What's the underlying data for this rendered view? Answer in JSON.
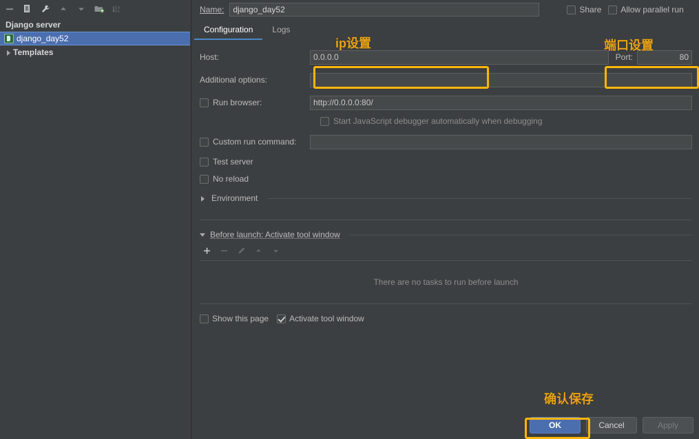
{
  "sidebar": {
    "toolbar": [
      {
        "name": "remove-config-button",
        "icon": "minus-icon"
      },
      {
        "name": "copy-config-button",
        "icon": "copy-icon"
      },
      {
        "name": "edit-templates-button",
        "icon": "wrench-icon"
      },
      {
        "name": "move-up-button",
        "icon": "arrow-up-icon"
      },
      {
        "name": "move-down-button",
        "icon": "arrow-down-icon"
      },
      {
        "name": "move-into-folder-button",
        "icon": "folder-add-icon"
      },
      {
        "name": "sort-configurations-button",
        "icon": "sort-alpha-icon"
      }
    ],
    "tree": [
      {
        "label": "Django server",
        "type": "group",
        "selected": false
      },
      {
        "label": "django_day52",
        "type": "child",
        "selected": true,
        "icon": "django-icon"
      },
      {
        "label": "Templates",
        "type": "group",
        "selected": false,
        "expander": "right"
      }
    ]
  },
  "header": {
    "name_label": "Name:",
    "name_value": "django_day52",
    "share_label": "Share",
    "share_checked": false,
    "allow_parallel_label": "Allow parallel run",
    "allow_parallel_checked": false
  },
  "tabs": [
    {
      "label": "Configuration",
      "active": true
    },
    {
      "label": "Logs",
      "active": false
    }
  ],
  "form": {
    "host_label": "Host:",
    "host_value": "0.0.0.0",
    "port_label": "Port:",
    "port_value": "80",
    "additional_options_label": "Additional options:",
    "additional_options_value": "",
    "run_browser_label": "Run browser:",
    "run_browser_checked": false,
    "run_browser_url": "http://0.0.0.0:80/",
    "js_debugger_label": "Start JavaScript debugger automatically when debugging",
    "js_debugger_checked": false,
    "custom_run_command_label": "Custom run command:",
    "custom_run_command_checked": false,
    "custom_run_command_value": "",
    "test_server_label": "Test server",
    "test_server_checked": false,
    "no_reload_label": "No reload",
    "no_reload_checked": false,
    "environment_label": "Environment"
  },
  "before_launch": {
    "title": "Before launch: Activate tool window",
    "toolbar": [
      {
        "name": "add-task-button",
        "icon": "plus-icon",
        "enabled": true
      },
      {
        "name": "remove-task-button",
        "icon": "minus-icon",
        "enabled": false
      },
      {
        "name": "edit-task-button",
        "icon": "pencil-icon",
        "enabled": false
      },
      {
        "name": "task-move-up-button",
        "icon": "arrow-up-icon",
        "enabled": false
      },
      {
        "name": "task-move-down-button",
        "icon": "arrow-down-icon",
        "enabled": false
      }
    ],
    "empty_text": "There are no tasks to run before launch",
    "show_this_page_label": "Show this page",
    "show_this_page_checked": false,
    "activate_tool_window_label": "Activate tool window",
    "activate_tool_window_checked": true
  },
  "buttons": {
    "ok": "OK",
    "cancel": "Cancel",
    "apply": "Apply"
  },
  "annotations": [
    {
      "text": "ip设置",
      "name": "annotation-ip-setting"
    },
    {
      "text": "端口设置",
      "name": "annotation-port-setting"
    },
    {
      "text": "确认保存",
      "name": "annotation-confirm-save"
    }
  ],
  "colors": {
    "background": "#3c3f41",
    "field": "#45494a",
    "selection": "#4b6eaf",
    "accent": "#4a88c7",
    "annotation": "#e8a317",
    "highlight_box": "#ffb60a"
  }
}
